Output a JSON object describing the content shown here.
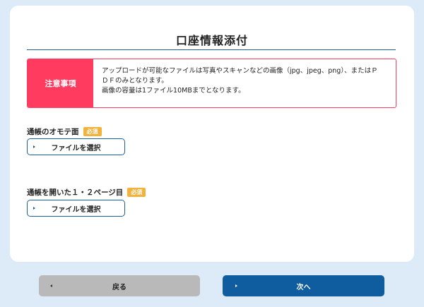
{
  "page": {
    "title": "口座情報添付"
  },
  "notice": {
    "label": "注意事項",
    "lines": [
      "アップロードが可能なファイルは写真やスキャンなどの画像（jpg、jpeg、png）、またはＰ",
      "ＤＦのみとなります。",
      "画像の容量は1ファイル10MBまでとなります。"
    ]
  },
  "fields": [
    {
      "label": "通帳のオモテ面",
      "badge": "必須",
      "button_label": "ファイルを選択"
    },
    {
      "label": "通帳を開いた１・２ページ目",
      "badge": "必須",
      "button_label": "ファイルを選択"
    }
  ],
  "nav": {
    "back_label": "戻る",
    "next_label": "次へ"
  },
  "colors": {
    "accent": "#1a5fa0",
    "notice": "#ff3b5f",
    "badge": "#f3b23c",
    "next_button": "#0f5c9e",
    "back_button": "#b9b9b9",
    "background": "#dcebf7"
  }
}
